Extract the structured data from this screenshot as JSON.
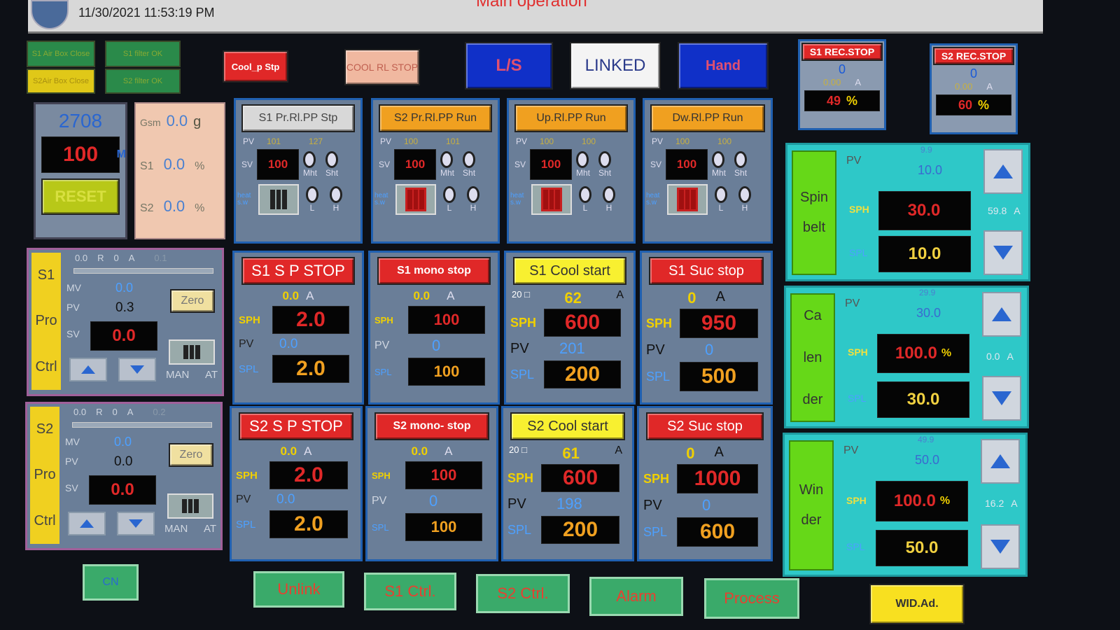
{
  "header": {
    "datetime": "11/30/2021 11:53:19 PM",
    "title": "Main operation"
  },
  "top_lamps": {
    "l1": "S1 Air Box Close",
    "l2": "S1 filter OK",
    "l3": "S2Air Box Close",
    "l4": "S2 filter OK"
  },
  "top_buttons": {
    "cool_p_stp": "Cool_p Stp",
    "cool_rl_stop": "COOL RL STOP",
    "ls": "L/S",
    "linked": "LINKED",
    "hand": "Hand"
  },
  "rec_stop": [
    {
      "title": "S1 REC.STOP",
      "value": "0",
      "amps": "0.00",
      "unit": "A",
      "pct": "49",
      "pct_unit": "%"
    },
    {
      "title": "S2 REC.STOP",
      "value": "0",
      "amps": "0.00",
      "unit": "A",
      "pct": "60",
      "pct_unit": "%"
    }
  ],
  "counter": {
    "count": "2708",
    "value": "100",
    "unit": "M",
    "reset": "RESET"
  },
  "gsm": {
    "gsm_label": "Gsm",
    "gsm_val": "0.0",
    "gsm_unit": "g",
    "s1_label": "S1",
    "s1_val": "0.0",
    "s1_unit": "%",
    "s2_label": "S2",
    "s2_val": "0.0",
    "s2_unit": "%"
  },
  "pumps": [
    {
      "btn": "S1 Pr.Rl.PP Stp",
      "pv_label": "PV",
      "pv1": "101",
      "pv2": "127",
      "sv_label": "SV",
      "sv": "100"
    },
    {
      "btn": "S2 Pr.Rl.PP Run",
      "pv_label": "PV",
      "pv1": "100",
      "pv2": "101",
      "sv_label": "SV",
      "sv": "100"
    },
    {
      "btn": "Up.Rl.PP Run",
      "pv_label": "PV",
      "pv1": "100",
      "pv2": "100",
      "sv_label": "SV",
      "sv": "100"
    },
    {
      "btn": "Dw.Rl.PP Run",
      "pv_label": "PV",
      "pv1": "100",
      "pv2": "100",
      "sv_label": "SV",
      "sv": "100"
    }
  ],
  "knob_labels": {
    "mht": "Mht",
    "sht": "Sht",
    "l": "L",
    "h": "H",
    "heat": "heat s.w"
  },
  "pro_ctrl": [
    {
      "tag1": "S1",
      "tag2": "Pro",
      "tag3": "Ctrl",
      "top1": "0.0",
      "top_r": "R",
      "top2": "0",
      "top_a": "A",
      "top3": "0.1",
      "mv_label": "MV",
      "mv": "0.0",
      "pv_label": "PV",
      "pv": "0.3",
      "sv_label": "SV",
      "sv": "0.0",
      "zero": "Zero",
      "man": "MAN",
      "at": "AT"
    },
    {
      "tag1": "S2",
      "tag2": "Pro",
      "tag3": "Ctrl",
      "top1": "0.0",
      "top_r": "R",
      "top2": "0",
      "top_a": "A",
      "top3": "0.2",
      "mv_label": "MV",
      "mv": "0.0",
      "pv_label": "PV",
      "pv": "0.0",
      "sv_label": "SV",
      "sv": "0.0",
      "zero": "Zero",
      "man": "MAN",
      "at": "AT"
    }
  ],
  "row1": [
    {
      "btn": "S1 S P STOP",
      "amp": "0.0",
      "unit": "A",
      "sph": "2.0",
      "pv": "0.0",
      "spl": "2.0"
    },
    {
      "btn": "S1 mono stop",
      "amp": "0.0",
      "unit": "A",
      "sph": "100",
      "pv": "0",
      "spl": "100"
    },
    {
      "btn": "S1 Cool start",
      "pre": "20 □",
      "amp": "62",
      "unit": "A",
      "sph": "600",
      "pv": "201",
      "spl": "200"
    },
    {
      "btn": "S1 Suc stop",
      "amp": "0",
      "unit": "A",
      "sph": "950",
      "pv": "0",
      "spl": "500"
    }
  ],
  "row2": [
    {
      "btn": "S2 S P STOP",
      "amp": "0.0",
      "unit": "A",
      "sph": "2.0",
      "pv": "0.0",
      "spl": "2.0"
    },
    {
      "btn": "S2 mono- stop",
      "amp": "0.0",
      "unit": "A",
      "sph": "100",
      "pv": "0",
      "spl": "100"
    },
    {
      "btn": "S2 Cool start",
      "pre": "20 □",
      "amp": "61",
      "unit": "A",
      "sph": "600",
      "pv": "198",
      "spl": "200"
    },
    {
      "btn": "S2 Suc stop",
      "amp": "0",
      "unit": "A",
      "sph": "1000",
      "pv": "0",
      "spl": "600"
    }
  ],
  "labels": {
    "sph": "SPH",
    "pv": "PV",
    "spl": "SPL"
  },
  "drives": [
    {
      "t1": "Spin",
      "t2": "",
      "t3": "belt",
      "top": "9.9",
      "pv": "10.0",
      "sph": "30.0",
      "sph_unit": "",
      "spl": "10.0",
      "amp": "59.8",
      "unit": "A"
    },
    {
      "t1": "Ca",
      "t2": "len",
      "t3": "der",
      "top": "29.9",
      "pv": "30.0",
      "sph": "100.0",
      "sph_unit": "%",
      "spl": "30.0",
      "amp": "0.0",
      "unit": "A"
    },
    {
      "t1": "Win",
      "t2": "der",
      "t3": "",
      "top": "49.9",
      "pv": "50.0",
      "sph": "100.0",
      "sph_unit": "%",
      "spl": "50.0",
      "amp": "16.2",
      "unit": "A"
    }
  ],
  "bottom": {
    "cn": "CN",
    "unlink": "Unlink",
    "s1ctrl": "S1 Ctrl.",
    "s2ctrl": "S2 Ctrl.",
    "alarm": "Alarm",
    "process": "Process",
    "wid": "WID.Ad."
  }
}
